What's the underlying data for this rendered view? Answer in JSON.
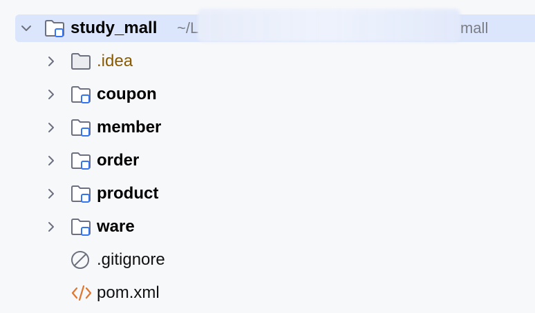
{
  "root": {
    "name": "study_mall",
    "path_prefix": "~/L",
    "path_suffix": "mall",
    "expanded": true
  },
  "children": [
    {
      "name": ".idea",
      "kind": "folder-excluded",
      "expandable": true
    },
    {
      "name": "coupon",
      "kind": "module",
      "expandable": true
    },
    {
      "name": "member",
      "kind": "module",
      "expandable": true
    },
    {
      "name": "order",
      "kind": "module",
      "expandable": true
    },
    {
      "name": "product",
      "kind": "module",
      "expandable": true
    },
    {
      "name": "ware",
      "kind": "module",
      "expandable": true
    },
    {
      "name": ".gitignore",
      "kind": "ignore-file",
      "expandable": false
    },
    {
      "name": "pom.xml",
      "kind": "xml-file",
      "expandable": false
    }
  ],
  "colors": {
    "selection": "#dbe5fb",
    "module_badge": "#3574f0",
    "excluded_text": "#8a5a00",
    "xml_icon": "#e0752d"
  }
}
